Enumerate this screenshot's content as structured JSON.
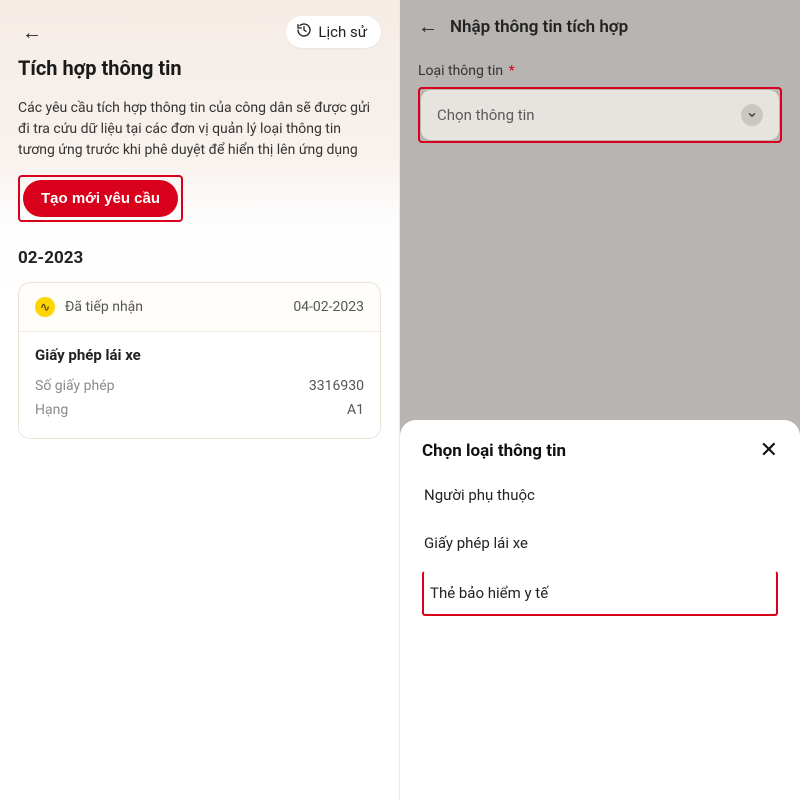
{
  "left": {
    "history_label": "Lịch sử",
    "title": "Tích hợp thông tin",
    "description": "Các yêu cầu tích hợp thông tin của công dân sẽ được gửi đi tra cứu dữ liệu tại các đơn vị quản lý loại thông tin tương ứng trước khi phê duyệt để hiển thị lên ứng dụng",
    "cta_label": "Tạo mới yêu cầu",
    "month": "02-2023",
    "card": {
      "status": "Đã tiếp nhận",
      "status_icon": "∿",
      "date": "04-02-2023",
      "doc_title": "Giấy phép lái xe",
      "rows": [
        {
          "label": "Số giấy phép",
          "value": "3316930"
        },
        {
          "label": "Hạng",
          "value": "A1"
        }
      ]
    }
  },
  "right": {
    "header_title": "Nhập thông tin tích hợp",
    "field_label": "Loại thông tin",
    "required_mark": "*",
    "select_placeholder": "Chọn thông tin",
    "sheet": {
      "title": "Chọn loại thông tin",
      "options": [
        "Người phụ thuộc",
        "Giấy phép lái xe",
        "Thẻ bảo hiểm y tế"
      ]
    }
  }
}
